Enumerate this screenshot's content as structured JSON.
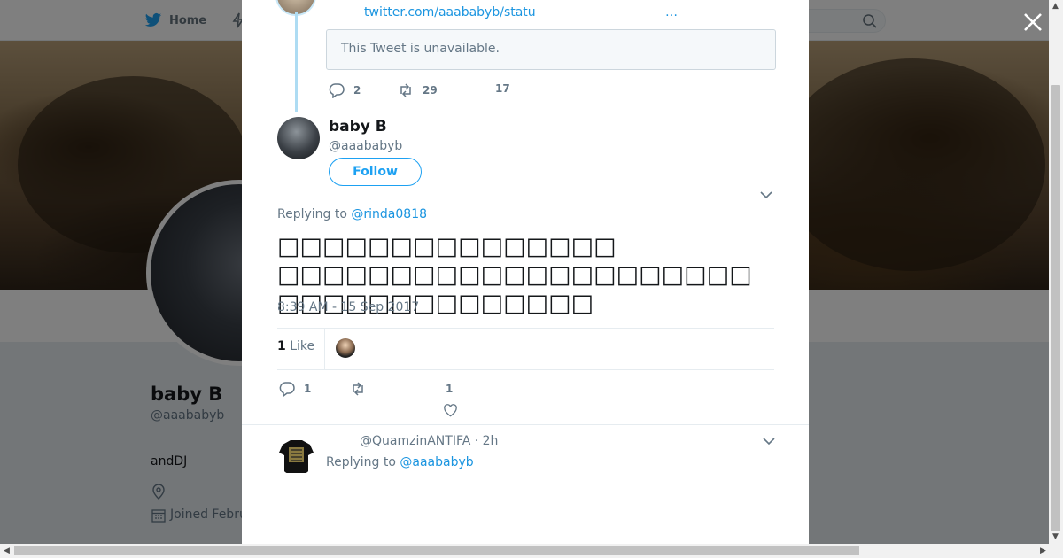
{
  "nav": {
    "home_label": "Home"
  },
  "profile": {
    "name": "baby B",
    "handle": "@aaababyb",
    "bio": "andDJ",
    "joined": "Joined Febru"
  },
  "previous_tweet": {
    "link_text": "twitter.com/aaababyb/statu",
    "ellipsis": "…",
    "unavailable_text": "This Tweet is unavailable.",
    "replies": "2",
    "retweets": "29",
    "likes": "17"
  },
  "tweet": {
    "name": "baby B",
    "handle": "@aaababyb",
    "follow_label": "Follow",
    "replying_prefix": "Replying to",
    "replying_to": "@rinda0818",
    "text_line1": "□□□□□□□□□□□□□□□",
    "text_line2": "□□□□□□□□□□□□□□□□□□□□□□□□□□□□□□□□□□□",
    "timestamp": "8:39 AM - 15 Sep 2017",
    "like_count": "1",
    "like_word": "Like",
    "replies": "1",
    "likes": "1"
  },
  "reply": {
    "handle_time": "@QuamzinANTIFA · 2h",
    "replying_prefix": "Replying to",
    "replying_to": "@aaababyb"
  },
  "colors": {
    "accent": "#1da1f2",
    "link": "#1b95e0",
    "muted": "#657786"
  }
}
